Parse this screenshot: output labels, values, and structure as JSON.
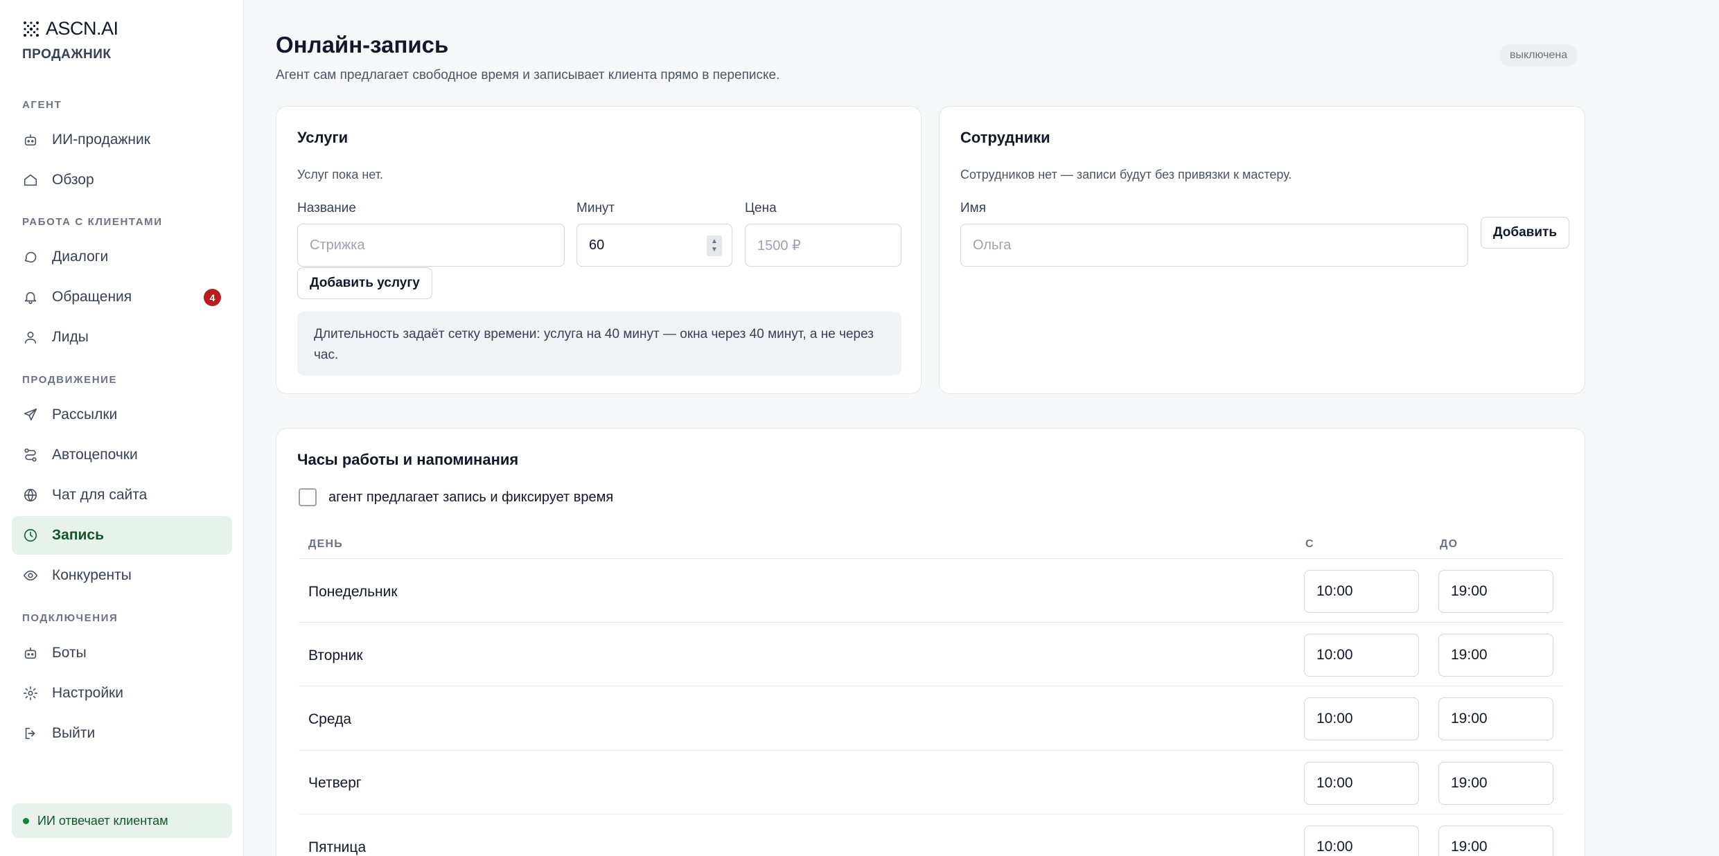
{
  "brand": {
    "name": "ASCN.AI",
    "product": "ПРОДАЖНИК"
  },
  "sidebar": {
    "sections": [
      {
        "label": "АГЕНТ"
      },
      {
        "label": "РАБОТА С КЛИЕНТАМИ"
      },
      {
        "label": "ПРОДВИЖЕНИЕ"
      },
      {
        "label": "ПОДКЛЮЧЕНИЯ"
      }
    ],
    "items": [
      {
        "label": "ИИ-продажник",
        "icon": "robot-icon"
      },
      {
        "label": "Обзор",
        "icon": "home-icon"
      },
      {
        "label": "Диалоги",
        "icon": "chat-icon"
      },
      {
        "label": "Обращения",
        "icon": "bell-icon",
        "badge": "4"
      },
      {
        "label": "Лиды",
        "icon": "user-icon"
      },
      {
        "label": "Рассылки",
        "icon": "send-icon"
      },
      {
        "label": "Автоцепочки",
        "icon": "route-icon"
      },
      {
        "label": "Чат для сайта",
        "icon": "globe-icon"
      },
      {
        "label": "Запись",
        "icon": "clock-icon",
        "active": true
      },
      {
        "label": "Конкуренты",
        "icon": "eye-icon"
      },
      {
        "label": "Боты",
        "icon": "robot-icon"
      },
      {
        "label": "Настройки",
        "icon": "gear-icon"
      },
      {
        "label": "Выйти",
        "icon": "logout-icon"
      }
    ],
    "status": "ИИ отвечает клиентам"
  },
  "page": {
    "title": "Онлайн-запись",
    "subtitle": "Агент сам предлагает свободное время и записывает клиента прямо в переписке.",
    "state_badge": "выключена"
  },
  "services": {
    "title": "Услуги",
    "empty": "Услуг пока нет.",
    "name_label": "Название",
    "name_placeholder": "Стрижка",
    "minutes_label": "Минут",
    "minutes_value": "60",
    "price_label": "Цена",
    "price_placeholder": "1500 ₽",
    "add_button": "Добавить услугу",
    "hint": "Длительность задаёт сетку времени: услуга на 40 минут — окна через 40 минут, а не через час."
  },
  "staff": {
    "title": "Сотрудники",
    "empty": "Сотрудников нет — записи будут без привязки к мастеру.",
    "name_label": "Имя",
    "name_placeholder": "Ольга",
    "add_button": "Добавить"
  },
  "hours": {
    "title": "Часы работы и напоминания",
    "checkbox_label": "агент предлагает запись и фиксирует время",
    "checkbox_checked": false,
    "columns": {
      "day": "ДЕНЬ",
      "from": "С",
      "to": "ДО"
    },
    "rows": [
      {
        "day": "Понедельник",
        "from": "10:00",
        "to": "19:00"
      },
      {
        "day": "Вторник",
        "from": "10:00",
        "to": "19:00"
      },
      {
        "day": "Среда",
        "from": "10:00",
        "to": "19:00"
      },
      {
        "day": "Четверг",
        "from": "10:00",
        "to": "19:00"
      },
      {
        "day": "Пятница",
        "from": "10:00",
        "to": "19:00"
      }
    ]
  },
  "colors": {
    "accent": "#166534",
    "accent_bg": "#e6f2ea",
    "badge": "#b91c1c"
  }
}
